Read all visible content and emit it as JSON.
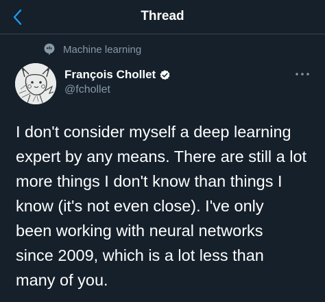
{
  "header": {
    "back_icon": "chevron-left-icon",
    "title": "Thread"
  },
  "topic": {
    "icon": "topic-pin-icon",
    "label": "Machine learning"
  },
  "author": {
    "avatar_icon": "avatar-pikachu-sketch",
    "name": "François Chollet",
    "verified_icon": "verified-badge-icon",
    "handle": "@fchollet"
  },
  "more_icon": "more-horizontal-icon",
  "tweet": {
    "text": "I don't consider myself a deep learning\nexpert by any means. There are still a lot\nmore things I don't know than things I\nknow (it's not even close). I've only\nbeen working with neural networks\nsince 2009, which is a lot less than\nmany of you."
  },
  "colors": {
    "background": "#15202b",
    "accent": "#1d9bf0",
    "secondary_text": "#8899a6",
    "divider": "#38444d"
  }
}
